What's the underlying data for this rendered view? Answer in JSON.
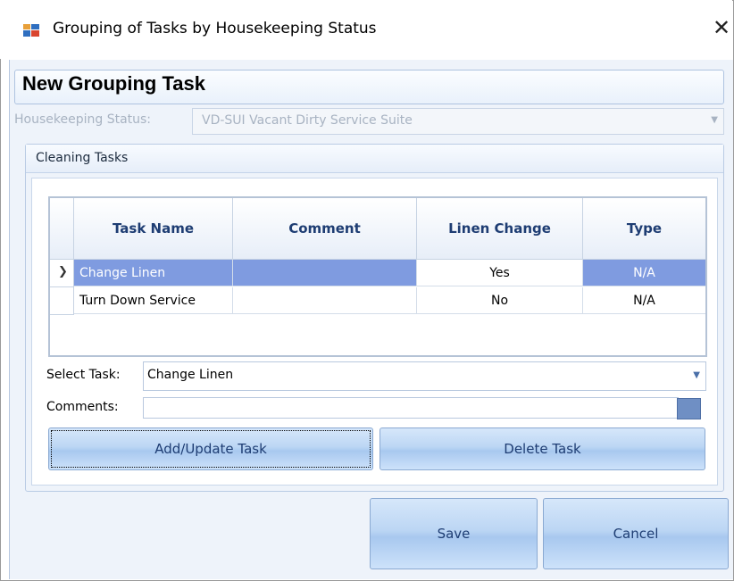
{
  "window": {
    "title": "Grouping of Tasks by Housekeeping Status",
    "close_glyph": "✕",
    "icon": "app-grid-icon"
  },
  "header": {
    "title": "New Grouping Task"
  },
  "housekeeping": {
    "label": "Housekeeping Status:",
    "value": "VD-SUI Vacant Dirty Service Suite",
    "disabled": true
  },
  "cleaning_tasks": {
    "group_title": "Cleaning Tasks",
    "columns": [
      "Task Name",
      "Comment",
      "Linen Change",
      "Type"
    ],
    "rows": [
      {
        "task_name": "Change Linen",
        "comment": "",
        "linen_change": "Yes",
        "type": "N/A",
        "selected": true
      },
      {
        "task_name": "Turn Down Service",
        "comment": "",
        "linen_change": "No",
        "type": "N/A",
        "selected": false
      }
    ],
    "row_indicator_glyph": "❯"
  },
  "select_task": {
    "label": "Select Task:",
    "value": "Change Linen"
  },
  "comments": {
    "label": "Comments:",
    "value": ""
  },
  "buttons": {
    "add_update": "Add/Update Task",
    "delete": "Delete Task",
    "save": "Save",
    "cancel": "Cancel"
  },
  "colors": {
    "selected_row": "#7f9be0",
    "header_text": "#1e3d73",
    "panel_bg": "#eef3fa"
  }
}
